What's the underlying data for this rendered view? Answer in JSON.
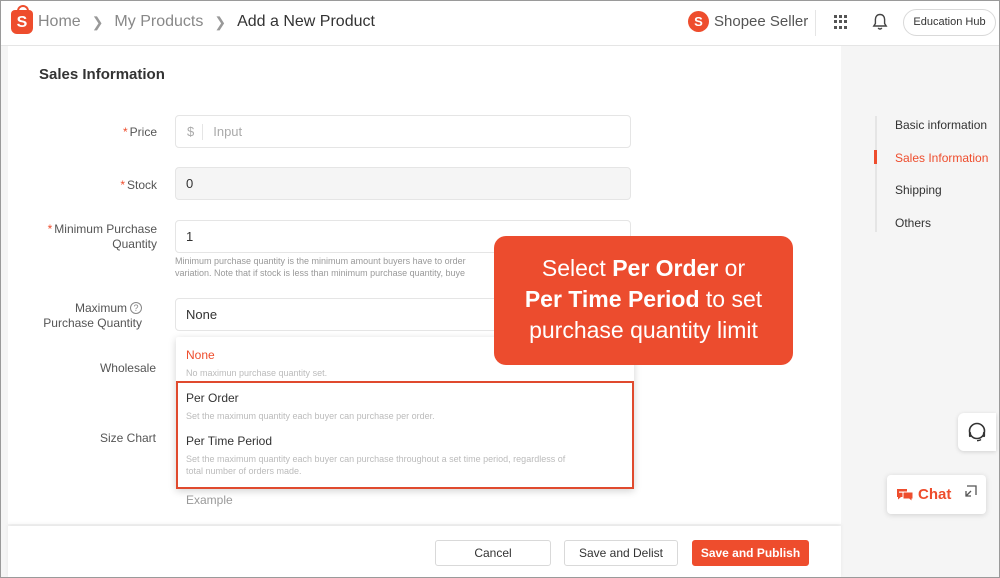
{
  "topbar": {
    "logo_letter": "S",
    "breadcrumb": [
      "Home",
      "My Products",
      "Add a New Product"
    ],
    "brand_label": "Shopee Seller",
    "brand_icon_letter": "S",
    "education_hub": "Education Hub"
  },
  "form": {
    "section_title": "Sales Information",
    "price": {
      "label": "Price",
      "prefix": "$",
      "placeholder": "Input"
    },
    "stock": {
      "label": "Stock",
      "value": "0"
    },
    "min_qty": {
      "label_line1": "Minimum Purchase",
      "label_line2": "Quantity",
      "value": "1",
      "hint_line1": "Minimum purchase quantity is the minimum amount buyers have to order",
      "hint_line2": "variation. Note that if stock is less than minimum purchase quantity, buye"
    },
    "max_qty": {
      "label_line1": "Maximum",
      "label_line2": "Purchase Quantity",
      "help_glyph": "?",
      "value": "None"
    },
    "wholesale_label": "Wholesale",
    "size_chart_label": "Size Chart",
    "example_text": "Example"
  },
  "dropdown": {
    "options": [
      {
        "title": "None",
        "desc": "No maximun purchase quantity set."
      },
      {
        "title": "Per Order",
        "desc": "Set the maximum quantity each buyer can purchase per order."
      },
      {
        "title": "Per Time Period",
        "desc_line1": "Set the maximum quantity each buyer can purchase throughout a set time period, regardless of",
        "desc_line2": "total number of orders made."
      }
    ],
    "selected": "None"
  },
  "callout": {
    "line1_a": "Select ",
    "line1_b": "Per Order",
    "line1_c": " or",
    "line2_a": "Per Time Period",
    "line2_b": " to set",
    "line3": "purchase quantity limit"
  },
  "actions": {
    "cancel": "Cancel",
    "save_delist": "Save and Delist",
    "save_publish": "Save and Publish"
  },
  "side_nav": {
    "items": [
      "Basic information",
      "Sales Information",
      "Shipping",
      "Others"
    ],
    "active": "Sales Information"
  },
  "chat": {
    "label": "Chat"
  },
  "colors": {
    "brand": "#ee4d2d",
    "callout": "#ec4c2e",
    "highlight_border": "#e04a2e"
  },
  "icons": [
    "shopee-logo-icon",
    "chevron-right-icon",
    "apps-grid-icon",
    "bell-icon",
    "help-circle-icon",
    "headset-icon",
    "chat-icon",
    "minimize-icon"
  ]
}
